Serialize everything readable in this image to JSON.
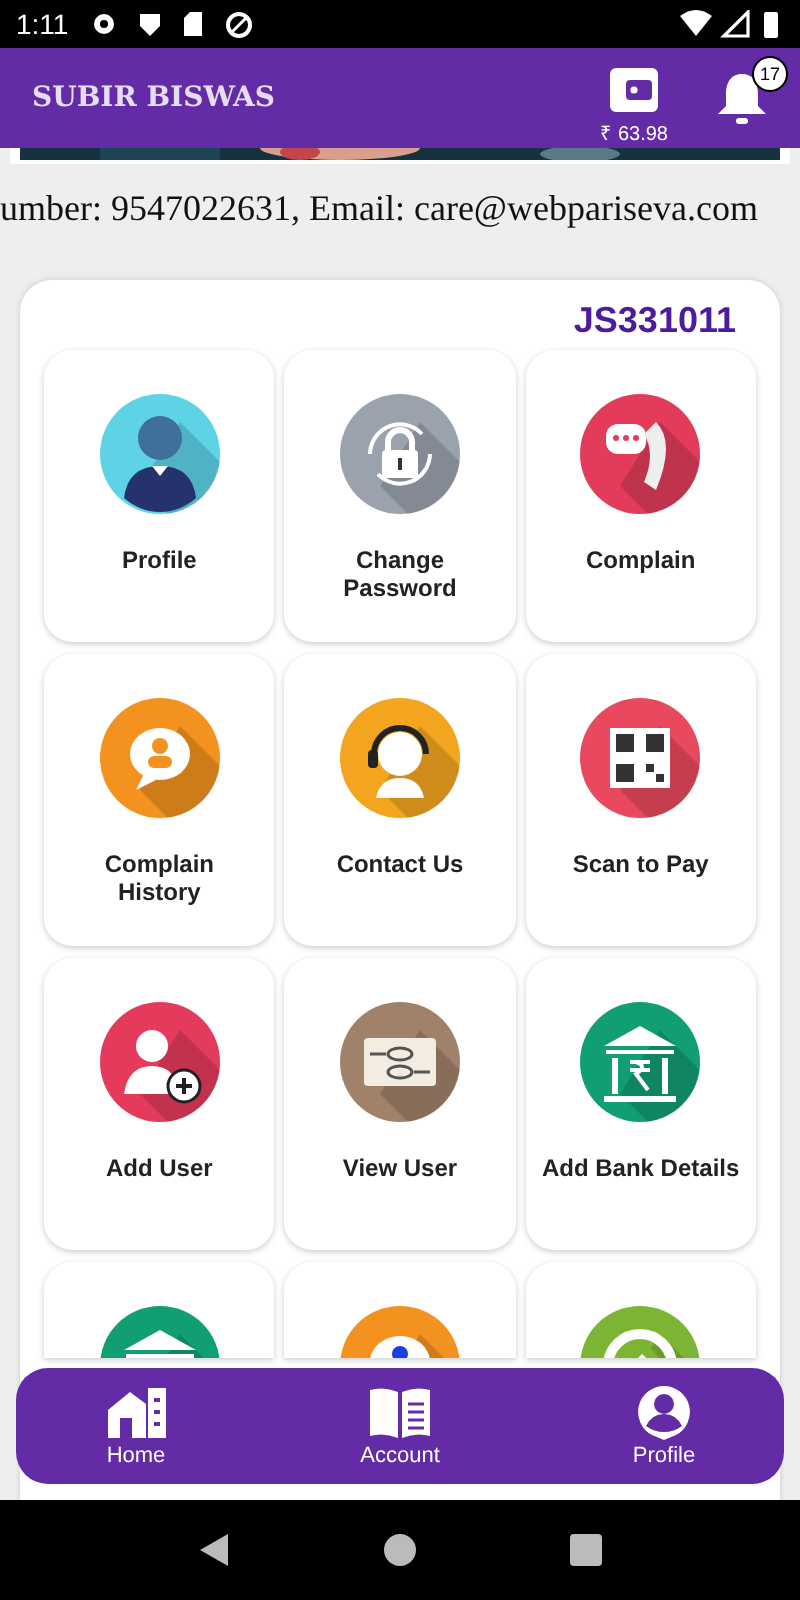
{
  "status_bar": {
    "time": "1:11"
  },
  "header": {
    "title": "SUBIR BISWAS",
    "wallet_amount": "₹ 63.98",
    "notification_count": "17"
  },
  "contact_line": "umber: 9547022631, Email: care@webpariseva.com",
  "panel": {
    "code": "JS331011",
    "tiles": [
      {
        "label": "Profile"
      },
      {
        "label": "Change Password"
      },
      {
        "label": "Complain"
      },
      {
        "label": "Complain History"
      },
      {
        "label": "Contact Us"
      },
      {
        "label": "Scan to Pay"
      },
      {
        "label": "Add User"
      },
      {
        "label": "View User"
      },
      {
        "label": "Add Bank Details"
      }
    ]
  },
  "bottom_nav": [
    {
      "label": "Home"
    },
    {
      "label": "Account"
    },
    {
      "label": "Profile"
    }
  ]
}
